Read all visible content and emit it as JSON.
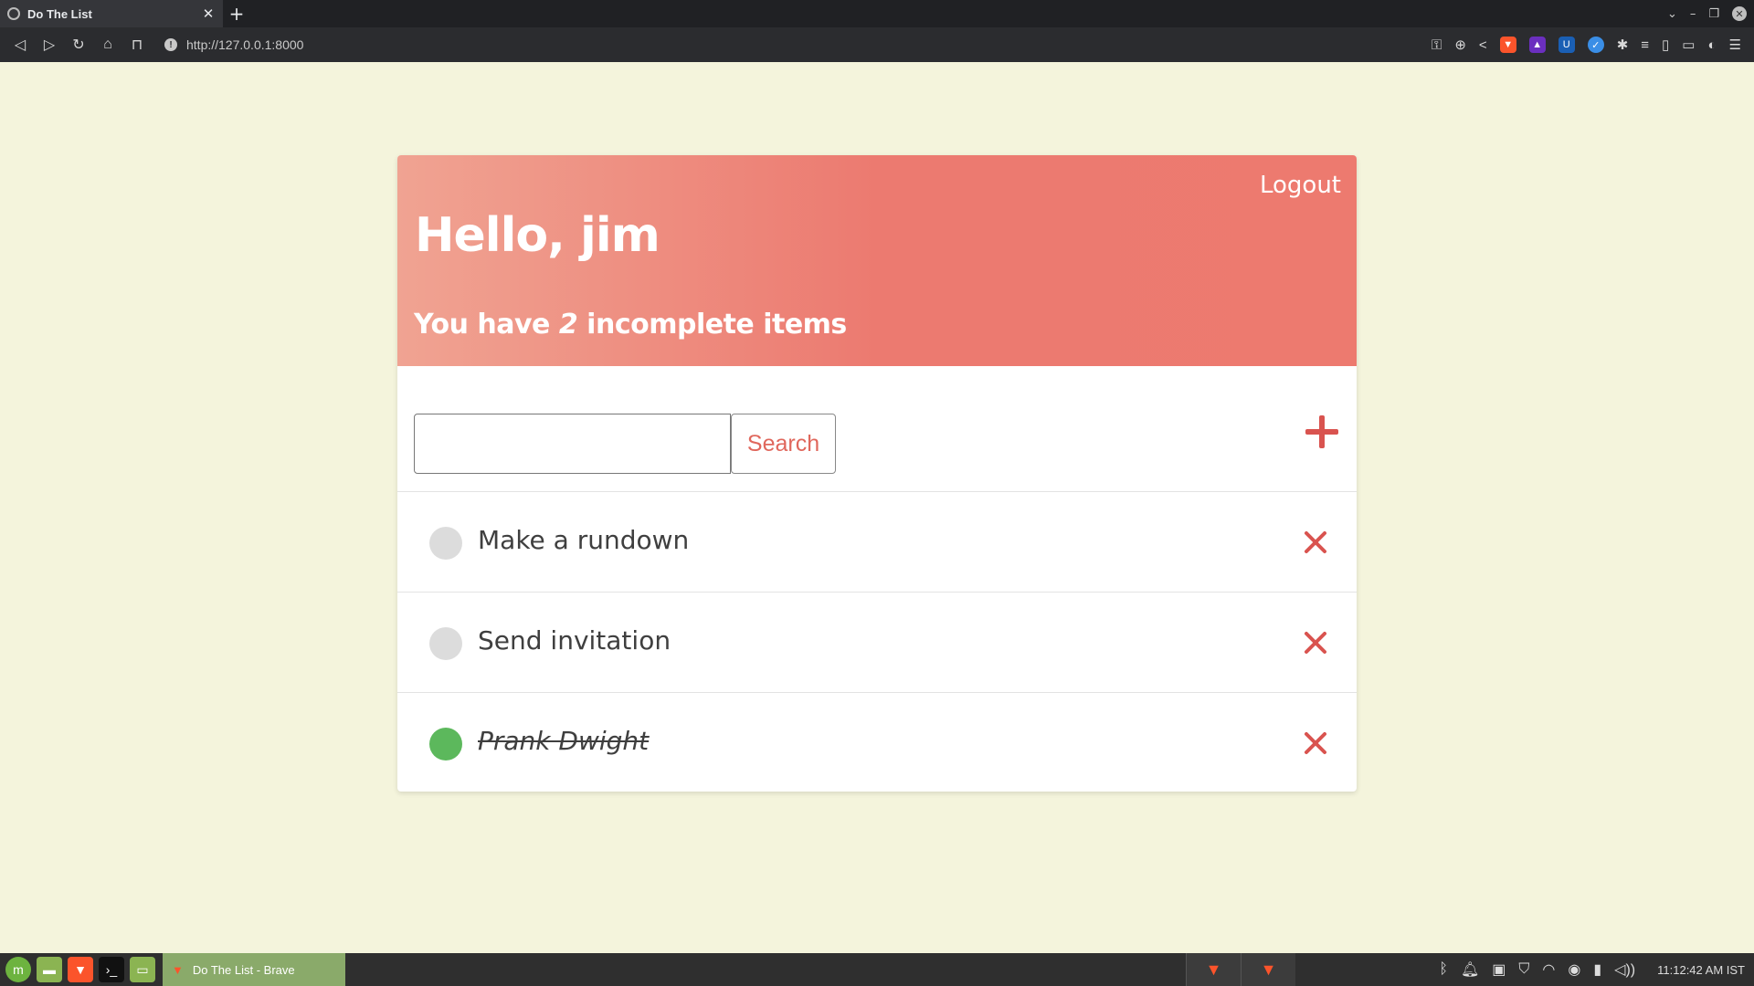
{
  "browser": {
    "tab_title": "Do The List",
    "url": "http://127.0.0.1:8000",
    "colors": {
      "chrome_bg": "#202124",
      "toolbar_bg": "#2b2c2f"
    }
  },
  "header": {
    "logout_label": "Logout",
    "greeting": "Hello, jim",
    "summary_prefix": "You have",
    "incomplete_count": "2",
    "summary_suffix": "incomplete items"
  },
  "search": {
    "value": "",
    "button_label": "Search"
  },
  "todos": [
    {
      "text": "Make a rundown",
      "completed": false
    },
    {
      "text": "Send invitation",
      "completed": false
    },
    {
      "text": "Prank Dwight",
      "completed": true
    }
  ],
  "taskbar": {
    "window_label": "Do The List - Brave",
    "clock": "11:12:42 AM IST"
  },
  "colors": {
    "page_bg": "#f4f4dc",
    "header_gradient_start": "#f0a392",
    "header_gradient_end": "#ec7a70",
    "accent_red": "#e0675c",
    "delete_red": "#d9534f",
    "completed_green": "#5cb85c",
    "incomplete_gray": "#dcdcdc"
  }
}
